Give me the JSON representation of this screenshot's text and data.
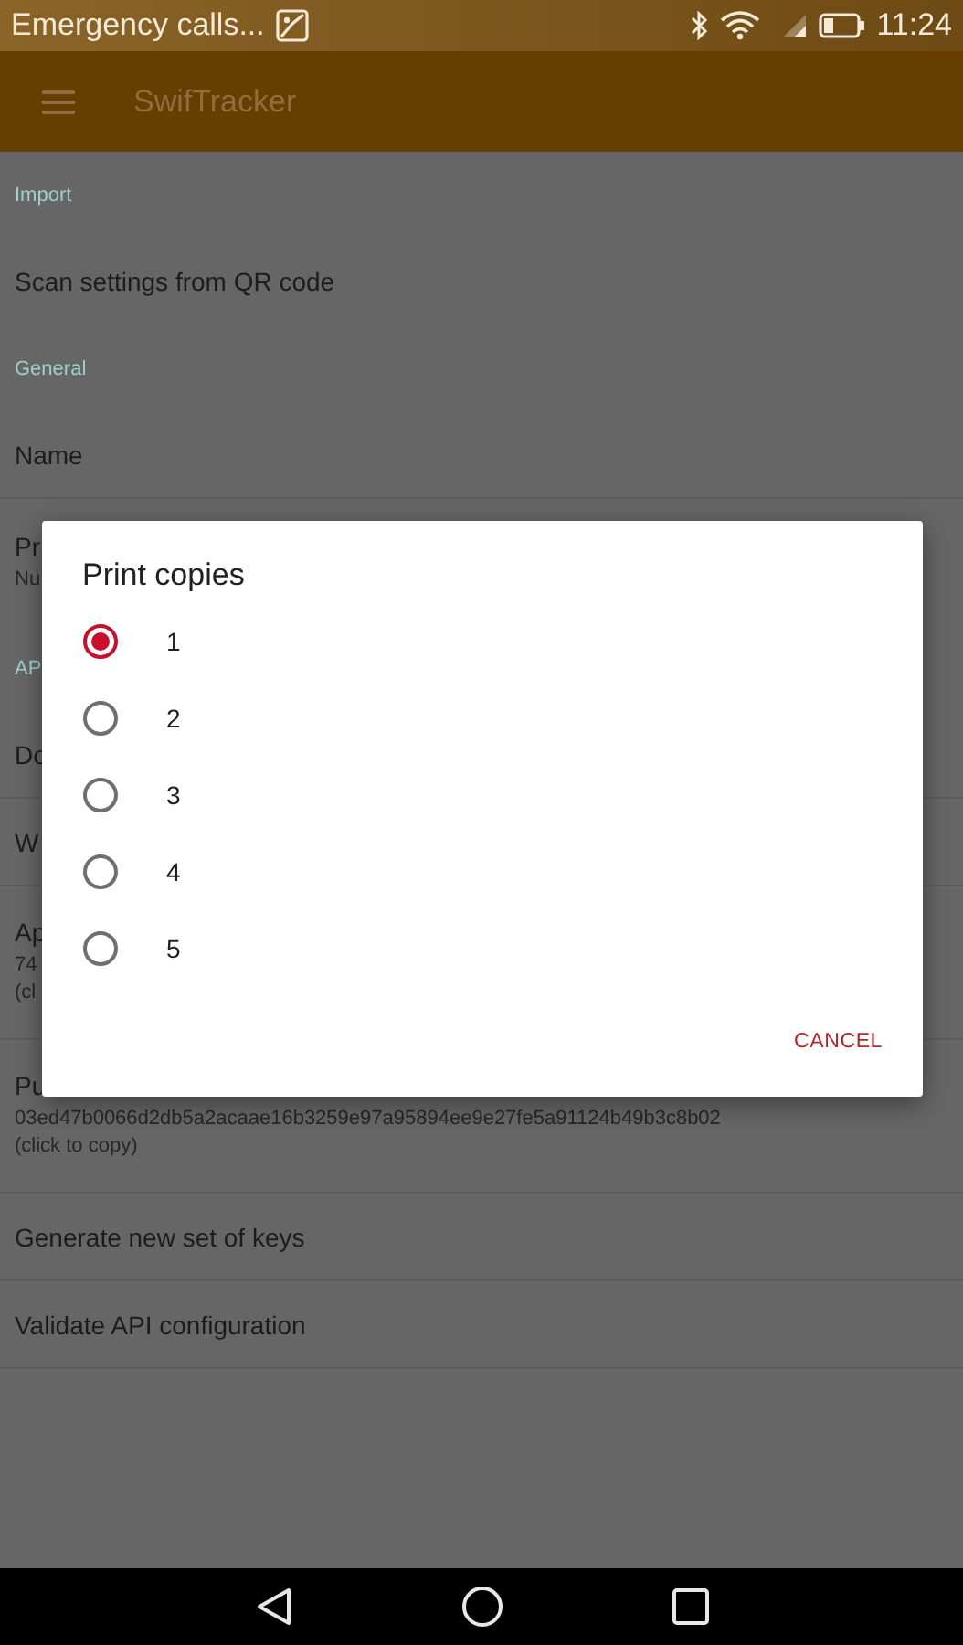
{
  "status_bar": {
    "notification": "Emergency calls...",
    "time": "11:24"
  },
  "app_bar": {
    "title": "SwifTracker"
  },
  "settings": [
    {
      "kind": "header",
      "text": "Import"
    },
    {
      "kind": "item",
      "title": "Scan settings from QR code"
    },
    {
      "kind": "header",
      "text": "General"
    },
    {
      "kind": "item",
      "title": "Name"
    },
    {
      "kind": "item",
      "title": "Pr",
      "summary": [
        "Nu"
      ]
    },
    {
      "kind": "header",
      "text": "AP"
    },
    {
      "kind": "item",
      "title": "Do"
    },
    {
      "kind": "item",
      "title": "W"
    },
    {
      "kind": "item",
      "title": "Ap",
      "summary": [
        "74",
        "(cl"
      ]
    },
    {
      "kind": "item",
      "title": "Pu",
      "summary": [
        "03ed47b0066d2db5a2acaae16b3259e97a95894ee9e27fe5a91124b49b3c8b02",
        "(click to copy)"
      ]
    },
    {
      "kind": "item",
      "title": "Generate new set of keys"
    },
    {
      "kind": "item",
      "title": "Validate API configuration"
    }
  ],
  "dialog": {
    "title": "Print copies",
    "options": [
      {
        "label": "1",
        "selected": true
      },
      {
        "label": "2",
        "selected": false
      },
      {
        "label": "3",
        "selected": false
      },
      {
        "label": "4",
        "selected": false
      },
      {
        "label": "5",
        "selected": false
      }
    ],
    "button": "CANCEL"
  }
}
